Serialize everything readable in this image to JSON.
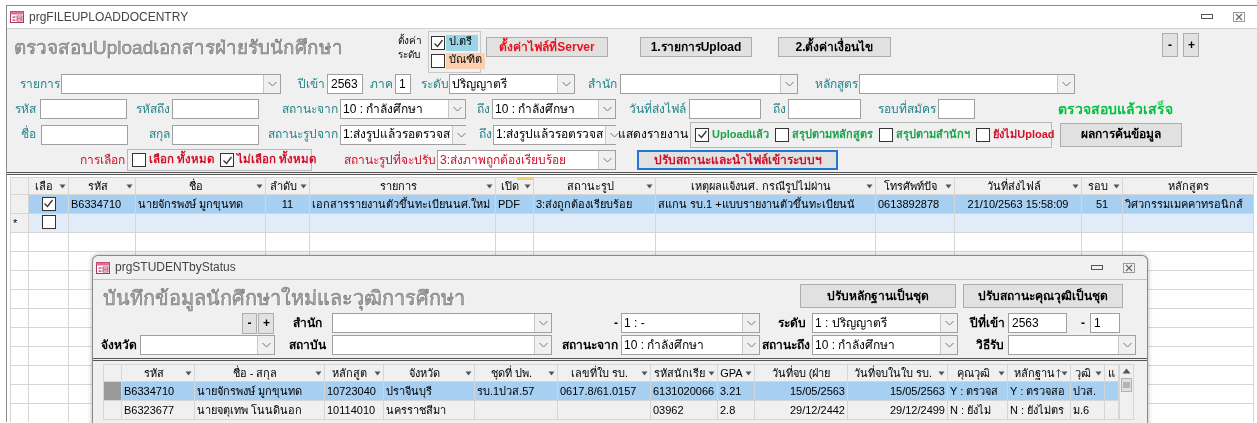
{
  "window": {
    "title": "prgFILEUPLOADDOCENTRY"
  },
  "form": {
    "top": [
      {
        "kind": "heading",
        "text": "ตรวจสอบUploadเอกสารฝ่ายรับนักศึกษา"
      },
      {
        "kind": "stack",
        "lines": [
          "ตั้งค่า",
          "ระดับ"
        ]
      },
      {
        "kind": "vgroup",
        "options": [
          {
            "label": "ป.ตรี",
            "checked": true,
            "color": "#99d5e6"
          },
          {
            "label": "บัณฑิต",
            "checked": false,
            "color": "#fbd0b0"
          }
        ]
      },
      {
        "kind": "button",
        "text": "ตั้งค่าไฟล์ที่Server",
        "color": "#e8141e",
        "focused": false
      },
      {
        "kind": "button",
        "text": "1.รายการUpload",
        "focused": false
      },
      {
        "kind": "button",
        "text": "2.ตั้งค่าเงื่อนไข",
        "focused": false
      },
      {
        "kind": "button",
        "text": "-",
        "focused": false
      },
      {
        "kind": "button",
        "text": "+",
        "focused": false
      }
    ],
    "lines": [
      [
        {
          "kind": "label",
          "text": "รายการ",
          "color": "#23858a"
        },
        {
          "kind": "combo"
        },
        {
          "kind": "label",
          "text": "ปีเข้า",
          "color": "#23858a"
        },
        {
          "kind": "text",
          "value": "2563"
        },
        {
          "kind": "label",
          "text": "ภาค",
          "color": "#23858a"
        },
        {
          "kind": "text",
          "value": "1"
        },
        {
          "kind": "label",
          "text": "ระดับ",
          "color": "#23858a"
        },
        {
          "kind": "combo",
          "value": "ปริญญาตรี"
        },
        {
          "kind": "label",
          "text": "สำนัก",
          "color": "#23858a"
        },
        {
          "kind": "combo"
        },
        {
          "kind": "label",
          "text": "หลักสูตร",
          "color": "#23858a"
        },
        {
          "kind": "combo"
        }
      ],
      [
        {
          "kind": "label",
          "text": "รหัส",
          "color": "#23858a"
        },
        {
          "kind": "text"
        },
        {
          "kind": "label",
          "text": "รหัสถึง",
          "color": "#23858a"
        },
        {
          "kind": "text"
        },
        {
          "kind": "label",
          "text": "สถานะจาก",
          "color": "#23858a"
        },
        {
          "kind": "combo",
          "value": "10 : กำลังศึกษา"
        },
        {
          "kind": "label",
          "text": "ถึง",
          "color": "#23858a"
        },
        {
          "kind": "combo",
          "value": "10 : กำลังศึกษา"
        },
        {
          "kind": "label",
          "text": "วันที่ส่งไฟล์",
          "color": "#23858a"
        },
        {
          "kind": "text"
        },
        {
          "kind": "label",
          "text": "ถึง",
          "color": "#23858a"
        },
        {
          "kind": "text"
        },
        {
          "kind": "label",
          "text": "รอบที่สมัคร",
          "color": "#23858a"
        },
        {
          "kind": "text"
        },
        {
          "kind": "status",
          "text": "ตรวจสอบแล้วเสร็จ",
          "color": "#00c040"
        }
      ],
      [
        {
          "kind": "label",
          "text": "ชื่อ",
          "color": "#23858a"
        },
        {
          "kind": "text"
        },
        {
          "kind": "label",
          "text": "สกุล",
          "color": "#23858a"
        },
        {
          "kind": "text"
        },
        {
          "kind": "label",
          "text": "สถานะรูปจาก",
          "color": "#23858a"
        },
        {
          "kind": "combo",
          "value": "1:ส่งรูปแล้วรอตรวจส"
        },
        {
          "kind": "label",
          "text": "ถึง",
          "color": "#23858a"
        },
        {
          "kind": "combo",
          "value": "1:ส่งรูปแล้วรอตรวจส"
        },
        {
          "kind": "label",
          "text": "แสดงรายงาน"
        },
        {
          "kind": "hgroup",
          "options": [
            {
              "label": "Uploadแล้ว",
              "checked": true,
              "color": "#1aa34a"
            },
            {
              "label": "สรุปตามหลักสูตร",
              "checked": false,
              "color": "#1aa34a"
            },
            {
              "label": "สรุปตามสำนักฯ",
              "checked": false,
              "color": "#1aa34a"
            },
            {
              "label": "ยังไม่Upload",
              "checked": false,
              "color": "#d0102a"
            }
          ]
        },
        {
          "kind": "button",
          "text": "ผลการค้นข้อมูล",
          "focused": false
        }
      ],
      [
        {
          "kind": "label",
          "text": "การเลือก",
          "color": "#d0102a"
        },
        {
          "kind": "hgroup",
          "options": [
            {
              "label": "เลือก ทั้งหมด",
              "checked": false,
              "color": "#d0102a"
            },
            {
              "label": "ไม่เลือก ทั้งหมด",
              "checked": true,
              "color": "#d0102a"
            }
          ]
        },
        {
          "kind": "label",
          "text": "สถานะรูปที่จะปรับ",
          "color": "#d0102a"
        },
        {
          "kind": "combo",
          "value": "3:ส่งภาพถูกต้องเรียบร้อย",
          "color": "#d0102a"
        },
        {
          "kind": "button",
          "text": "ปรับสถานะและนำไฟล์เข้าระบบฯ",
          "color": "#d0102a",
          "focused": true
        }
      ]
    ]
  },
  "datasheet": {
    "check_column": {
      "label": "เลือ",
      "menu": true
    },
    "columns": [
      {
        "label": "รหัส",
        "menu": true,
        "highlighted": false
      },
      {
        "label": "ชื่อ",
        "menu": true,
        "highlighted": false
      },
      {
        "label": "ลำดับ",
        "menu": true,
        "highlighted": false
      },
      {
        "label": "รายการ",
        "menu": true,
        "highlighted": false
      },
      {
        "label": "เปิด",
        "menu": true,
        "highlighted": true
      },
      {
        "label": "สถานะรูป",
        "menu": true,
        "highlighted": false
      },
      {
        "label": "เหตุผลแจ้งนศ. กรณีรูปไม่ผ่าน",
        "menu": true,
        "highlighted": false
      },
      {
        "label": "โทรศัพท์ปัจ",
        "menu": true,
        "highlighted": false
      },
      {
        "label": "วันที่ส่งไฟล์",
        "menu": true,
        "highlighted": false
      },
      {
        "label": "รอบ",
        "menu": true,
        "highlighted": false
      },
      {
        "label": "หลักสูตร",
        "menu": false,
        "highlighted": false
      }
    ],
    "rows": [
      {
        "selected": true,
        "new": false,
        "checked": true,
        "cells": [
          "B6334710",
          "นายจักรพงษ์  มูกขุนทด",
          "11",
          "เอกสารรายงานตัวขึ้นทะเบียนนศ.ใหม่",
          "PDF",
          "3:ส่งถูกต้องเรียบร้อย",
          "สแกน รบ.1 +แบบรายงานตัวขึ้นทะเบียนนั",
          "0613892878",
          "21/10/2563 15:58:09",
          "51",
          "วิศวกรรมเมคคาทรอนิกส์"
        ]
      },
      {
        "selected": false,
        "new": true,
        "marker": "*",
        "checked": false,
        "cells": []
      }
    ]
  },
  "subwindow": {
    "title": "prgSTUDENTbyStatus",
    "top": [
      {
        "kind": "heading",
        "text": "บันทึกข้อมูลนักศึกษาใหม่และวุฒิการศึกษา"
      },
      {
        "kind": "button",
        "text": "ปรับหลักฐานเป็นชุด",
        "focused": false
      },
      {
        "kind": "button",
        "text": "ปรับสถานะคุณวุฒิเป็นชุด",
        "focused": false
      }
    ],
    "lines": [
      [
        {
          "kind": "button",
          "text": "-",
          "focused": false
        },
        {
          "kind": "button",
          "text": "+",
          "focused": false
        },
        {
          "kind": "label",
          "text": "สำนัก"
        },
        {
          "kind": "combo"
        },
        {
          "kind": "label",
          "text": "-"
        },
        {
          "kind": "combo",
          "value": "1 : -"
        },
        {
          "kind": "label",
          "text": "ระดับ"
        },
        {
          "kind": "combo",
          "value": "1 : ปริญญาตรี"
        },
        {
          "kind": "label",
          "text": "ปีที่เข้า"
        },
        {
          "kind": "text",
          "value": "2563"
        },
        {
          "kind": "label",
          "text": "-"
        },
        {
          "kind": "text",
          "value": "1"
        }
      ],
      [
        {
          "kind": "label",
          "text": "จังหวัด"
        },
        {
          "kind": "combo"
        },
        {
          "kind": "label",
          "text": "สถาบัน"
        },
        {
          "kind": "combo"
        },
        {
          "kind": "label",
          "text": "สถานะจาก"
        },
        {
          "kind": "combo",
          "value": "10 : กำลังศึกษา"
        },
        {
          "kind": "label",
          "text": "สถานะถึง"
        },
        {
          "kind": "combo",
          "value": "10 : กำลังศึกษา"
        },
        {
          "kind": "label",
          "text": "วิธีรับ"
        },
        {
          "kind": "combo"
        }
      ]
    ],
    "grid": {
      "columns": [
        {
          "label": "รหัส",
          "menu": true,
          "sorted": false
        },
        {
          "label": "ชื่อ - สกุล",
          "menu": true,
          "sorted": false
        },
        {
          "label": "หลักสูต",
          "menu": true,
          "sorted": false
        },
        {
          "label": "จังหวัด",
          "menu": true,
          "sorted": false
        },
        {
          "label": "ชุดที่ ปพ.",
          "menu": true,
          "sorted": false
        },
        {
          "label": "เลขที่ใบ รบ.",
          "menu": true,
          "sorted": false
        },
        {
          "label": "รหัสนักเรีย",
          "menu": true,
          "sorted": false
        },
        {
          "label": "GPA",
          "menu": true,
          "sorted": false
        },
        {
          "label": "วันที่จบ (ฝ่าย",
          "menu": false,
          "sorted": false
        },
        {
          "label": "วันที่จบในใบ รบ.",
          "menu": true,
          "sorted": false
        },
        {
          "label": "คุณวุฒิ",
          "menu": true,
          "sorted": false
        },
        {
          "label": "หลักฐาน",
          "menu": true,
          "sorted": true
        },
        {
          "label": "วุฒิ",
          "menu": true,
          "sorted": false
        },
        {
          "label": "แ",
          "menu": false,
          "sorted": false
        }
      ],
      "rows": [
        {
          "selected": true,
          "cells": [
            "B6334710",
            "นายจักรพงษ์  มูกขุนทด",
            "10723040",
            "ปราจีนบุรี",
            "รบ.1ปวส.57",
            "0617.8/61.0157",
            "6131020066",
            "3.21",
            "15/05/2563",
            "15/05/2563",
            "Y : ตรวจส",
            "Y : ตรวจสอ",
            "ปวส."
          ]
        },
        {
          "selected": false,
          "cells": [
            "B6323677",
            "นายจตุเทพ  โนนดินอก",
            "10114010",
            "นครราชสีมา",
            null,
            null,
            "03962",
            "2.8",
            "29/12/2442",
            "29/12/2499",
            "N : ยังไม่",
            "N : ยังไม่ตร",
            "ม.6"
          ]
        }
      ]
    }
  }
}
